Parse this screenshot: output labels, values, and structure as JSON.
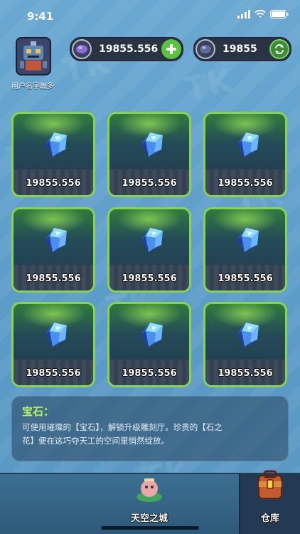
{
  "status": {
    "time": "9:41"
  },
  "profile": {
    "username": "用户名字最多"
  },
  "currency": [
    {
      "name": "gem-currency",
      "value": "19855.556",
      "action_icon": "plus-icon"
    },
    {
      "name": "stone-currency",
      "value": "19855",
      "action_icon": "refresh-icon"
    }
  ],
  "grid": {
    "items": [
      {
        "amount": "19855.556"
      },
      {
        "amount": "19855.556"
      },
      {
        "amount": "19855.556"
      },
      {
        "amount": "19855.556"
      },
      {
        "amount": "19855.556"
      },
      {
        "amount": "19855.556"
      },
      {
        "amount": "19855.556"
      },
      {
        "amount": "19855.556"
      },
      {
        "amount": "19855.556"
      }
    ]
  },
  "info": {
    "title": "宝石：",
    "line1": "可使用璀璨的【宝石】，解锁升级雕刻厅。珍贵的【石之",
    "line2": "花】便在这巧夺天工的空间里悄然绽放。"
  },
  "nav": {
    "sky_city": "天空之城",
    "storage": "仓库"
  },
  "colors": {
    "accent": "#89d44f",
    "title_green": "#b8f25a",
    "background": "#5b9bc7"
  }
}
